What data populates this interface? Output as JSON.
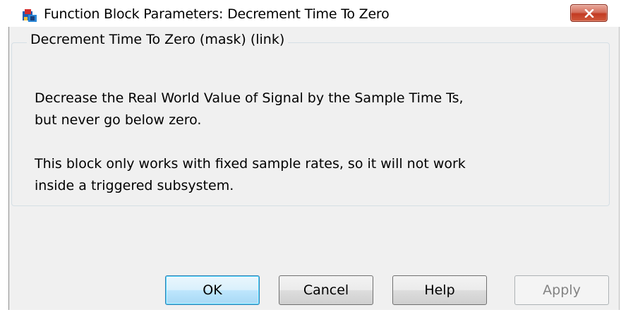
{
  "window": {
    "title": "Function Block Parameters: Decrement Time To Zero",
    "app_icon": "simulink-block-icon",
    "close_icon": "close-icon"
  },
  "group": {
    "title": "Decrement Time To Zero (mask) (link)",
    "description_lines_1": [
      "Decrease the Real World Value of Signal by the Sample Time Ts,",
      "but never go below zero."
    ],
    "description_lines_2": [
      "This block only works with fixed sample rates, so it will not work",
      "inside a triggered subsystem."
    ]
  },
  "buttons": {
    "ok": "OK",
    "cancel": "Cancel",
    "help": "Help",
    "apply": "Apply"
  },
  "colors": {
    "close_button": "#c23a22",
    "dialog_background": "#f0f0f0",
    "disabled_text": "#838383",
    "default_button_border": "#3c7fb1"
  }
}
